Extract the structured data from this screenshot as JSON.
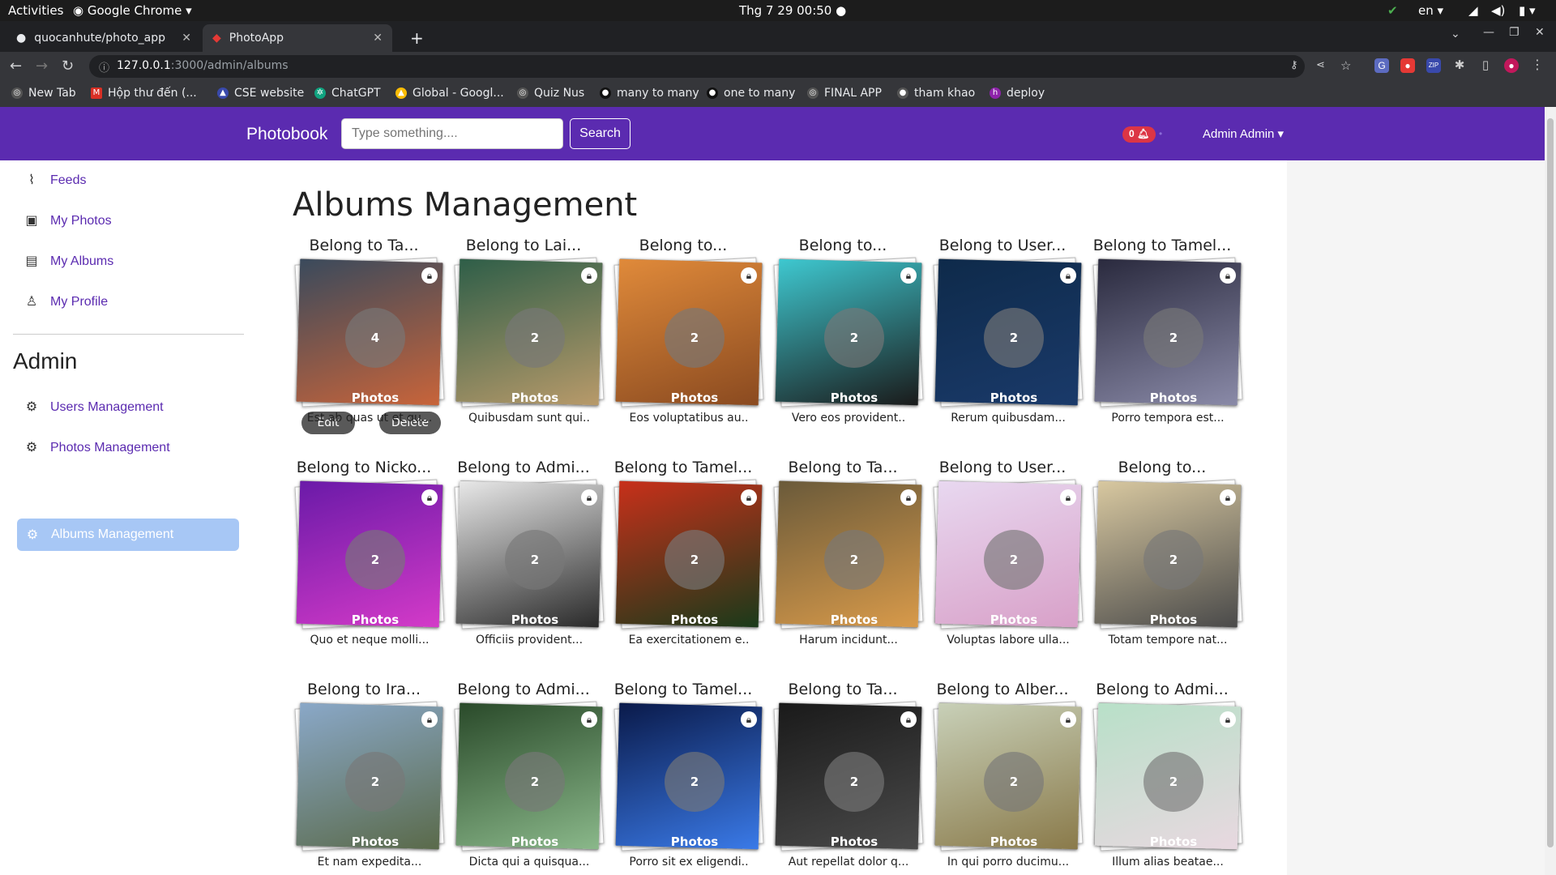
{
  "os": {
    "activities": "Activities",
    "app": "Google Chrome",
    "clock": "Thg 7 29  00:50",
    "lang": "en"
  },
  "tabs": [
    {
      "title": "quocanhute/photo_app",
      "active": false
    },
    {
      "title": "PhotoApp",
      "active": true
    }
  ],
  "address": {
    "host": "127.0.0.1",
    "path": ":3000/admin/albums"
  },
  "bookmarks": [
    "New Tab",
    "Hộp thư đến (...",
    "CSE website",
    "ChatGPT",
    "Global - Googl...",
    "Quiz Nus",
    "many to many",
    "one to many",
    "FINAL APP",
    "tham khao",
    "deploy"
  ],
  "navbar": {
    "brand": "Photobook",
    "search_placeholder": "Type something....",
    "search_label": "Search",
    "notif_count": "0",
    "user": "Admin Admin"
  },
  "sidebar": {
    "items": [
      "Feeds",
      "My Photos",
      "My Albums",
      "My Profile"
    ],
    "admin_title": "Admin",
    "admin_items": [
      "Users Management",
      "Photos Management",
      "Albums Management"
    ]
  },
  "main": {
    "title": "Albums Management"
  },
  "album_actions": {
    "edit": "Edit",
    "delete": "Delete"
  },
  "albums": [
    {
      "owner": "Belong to Ta...",
      "count": "4 Photos",
      "desc": "Est ab quas ut et qu...",
      "colors": [
        "#3a4a5c",
        "#c8643a"
      ]
    },
    {
      "owner": "Belong to Lai...",
      "count": "2 Photos",
      "desc": "Quibusdam sunt qui..",
      "colors": [
        "#2e5e48",
        "#b89a6a"
      ]
    },
    {
      "owner": "Belong to...",
      "count": "2 Photos",
      "desc": "Eos voluptatibus au..",
      "colors": [
        "#e08a3a",
        "#8a4a20"
      ]
    },
    {
      "owner": "Belong to...",
      "count": "2 Photos",
      "desc": "Vero eos provident..",
      "colors": [
        "#3ec8d0",
        "#1a1a1a"
      ]
    },
    {
      "owner": "Belong to User...",
      "count": "2 Photos",
      "desc": "Rerum quibusdam...",
      "colors": [
        "#0e2a4a",
        "#1a3a6a"
      ]
    },
    {
      "owner": "Belong to Tamel...",
      "count": "2 Photos",
      "desc": "Porro tempora est...",
      "colors": [
        "#2a2a3e",
        "#8a8aa8"
      ]
    },
    {
      "owner": "Belong to Nicko...",
      "count": "2 Photos",
      "desc": "Quo et neque molli...",
      "colors": [
        "#6a1aa8",
        "#d43ac8"
      ]
    },
    {
      "owner": "Belong to Admi...",
      "count": "2 Photos",
      "desc": "Officiis provident...",
      "colors": [
        "#e8e8e8",
        "#2a2a2a"
      ]
    },
    {
      "owner": "Belong to Tamel...",
      "count": "2 Photos",
      "desc": "Ea exercitationem e..",
      "colors": [
        "#c8301a",
        "#1a3a1a"
      ]
    },
    {
      "owner": "Belong to Ta...",
      "count": "2 Photos",
      "desc": "Harum incidunt...",
      "colors": [
        "#6a5a3a",
        "#d89a4a"
      ]
    },
    {
      "owner": "Belong to User...",
      "count": "2 Photos",
      "desc": "Voluptas labore ulla...",
      "colors": [
        "#e8d8f0",
        "#d8a0c8"
      ]
    },
    {
      "owner": "Belong to...",
      "count": "2 Photos",
      "desc": "Totam tempore nat...",
      "colors": [
        "#d8c8a0",
        "#4a4a4a"
      ]
    },
    {
      "owner": "Belong to Ira...",
      "count": "2 Photos",
      "desc": "Et nam expedita...",
      "colors": [
        "#8aa8c8",
        "#5a6a4a"
      ]
    },
    {
      "owner": "Belong to Admi...",
      "count": "2 Photos",
      "desc": "Dicta qui a quisqua...",
      "colors": [
        "#2a4a2a",
        "#8ab88a"
      ]
    },
    {
      "owner": "Belong to Tamel...",
      "count": "2 Photos",
      "desc": "Porro sit ex eligendi..",
      "colors": [
        "#0a1a4a",
        "#3a7ae8"
      ]
    },
    {
      "owner": "Belong to Ta...",
      "count": "2 Photos",
      "desc": "Aut repellat dolor q...",
      "colors": [
        "#1a1a1a",
        "#4a4a4a"
      ]
    },
    {
      "owner": "Belong to Alber...",
      "count": "2 Photos",
      "desc": "In qui porro ducimu...",
      "colors": [
        "#c8d0b8",
        "#8a7a4a"
      ]
    },
    {
      "owner": "Belong to Admi...",
      "count": "2 Photos",
      "desc": "Illum alias beatae...",
      "colors": [
        "#b8e0c8",
        "#e8d8e0"
      ]
    }
  ],
  "icons": {
    "feeds": "rss-icon",
    "photos": "image-icon",
    "albums": "images-icon",
    "profile": "user-icon",
    "admin": "gear-icon",
    "lock": "lock-icon",
    "bell": "bell-icon"
  },
  "colors": {
    "brand": "#5b2bb0",
    "active_bg": "#a7c7f5",
    "badge": "#dc3545"
  }
}
